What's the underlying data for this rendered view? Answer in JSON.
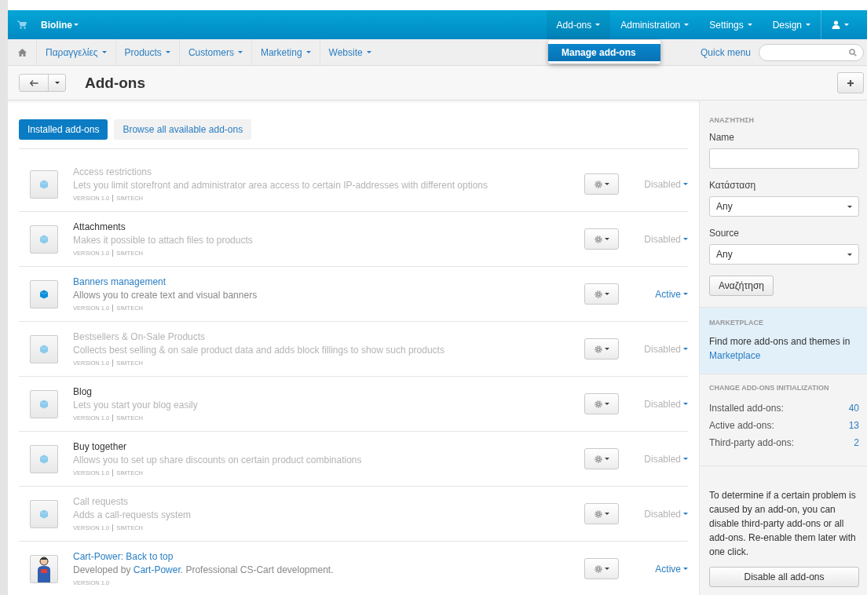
{
  "top_bar": {
    "store": "Bioline",
    "menus": [
      {
        "label": "Add-ons",
        "selected": true
      },
      {
        "label": "Administration",
        "selected": false
      },
      {
        "label": "Settings",
        "selected": false
      },
      {
        "label": "Design",
        "selected": false
      }
    ]
  },
  "dropdown": {
    "items": [
      {
        "label": "Manage add-ons",
        "selected": true
      }
    ]
  },
  "nav": {
    "items": [
      "Παραγγελίες",
      "Products",
      "Customers",
      "Marketing",
      "Website"
    ],
    "quick_menu": "Quick menu"
  },
  "title": "Add-ons",
  "tabs": [
    {
      "label": "Installed add-ons",
      "selected": true
    },
    {
      "label": "Browse all available add-ons",
      "selected": false
    }
  ],
  "addons": [
    {
      "kind": "cube",
      "name": "Access restrictions",
      "name_link": false,
      "name_dimmed": true,
      "description": [
        {
          "text": "Lets you limit storefront and administrator area access to certain IP-addresses with different options",
          "link": false
        }
      ],
      "version": "VERSION 1.0",
      "vendor": "SIMTECH",
      "status": "Disabled",
      "active": false
    },
    {
      "kind": "cube",
      "name": "Attachments",
      "name_link": false,
      "name_dimmed": false,
      "description": [
        {
          "text": "Makes it possible to attach files to products",
          "link": false
        }
      ],
      "version": "VERSION 1.0",
      "vendor": "SIMTECH",
      "status": "Disabled",
      "active": false
    },
    {
      "kind": "cube",
      "name": "Banners management",
      "name_link": true,
      "name_dimmed": false,
      "description": [
        {
          "text": "Allows you to create text and visual banners",
          "link": false
        }
      ],
      "version": "VERSION 1.0",
      "vendor": "SIMTECH",
      "status": "Active",
      "active": true
    },
    {
      "kind": "cube",
      "name": "Bestsellers & On-Sale Products",
      "name_link": false,
      "name_dimmed": true,
      "description": [
        {
          "text": "Collects best selling & on sale product data and adds block fillings to show such products",
          "link": false
        }
      ],
      "version": "VERSION 1.0",
      "vendor": "SIMTECH",
      "status": "Disabled",
      "active": false
    },
    {
      "kind": "cube",
      "name": "Blog",
      "name_link": false,
      "name_dimmed": false,
      "description": [
        {
          "text": "Lets you start your blog easily",
          "link": false
        }
      ],
      "version": "VERSION 1.0",
      "vendor": "SIMTECH",
      "status": "Disabled",
      "active": false
    },
    {
      "kind": "cube",
      "name": "Buy together",
      "name_link": false,
      "name_dimmed": false,
      "description": [
        {
          "text": "Allows you to set up share discounts on certain product combinations",
          "link": false
        }
      ],
      "version": "VERSION 1.0",
      "vendor": "SIMTECH",
      "status": "Disabled",
      "active": false
    },
    {
      "kind": "cube",
      "name": "Call requests",
      "name_link": false,
      "name_dimmed": true,
      "description": [
        {
          "text": "Adds a call-requests system",
          "link": false
        }
      ],
      "version": "VERSION 1.0",
      "vendor": "SIMTECH",
      "status": "Disabled",
      "active": false
    },
    {
      "kind": "figure",
      "name": "Cart-Power: Back to top",
      "name_link": true,
      "name_dimmed": false,
      "description": [
        {
          "text": "Developed by ",
          "link": false
        },
        {
          "text": "Cart-Power",
          "link": true
        },
        {
          "text": ". Professional CS-Cart development.",
          "link": false
        }
      ],
      "version": "VERSION 1.0",
      "status": "Active",
      "active": true
    }
  ],
  "sidebar": {
    "search": {
      "heading": "ΑΝΑΖΉΤΗΣΗ",
      "name_label": "Name",
      "status_label": "Κατάσταση",
      "status_value": "Any",
      "source_label": "Source",
      "source_value": "Any",
      "button": "Αναζήτηση"
    },
    "marketplace": {
      "heading": "MARKETPLACE",
      "text": "Find more add-ons and themes in",
      "link": "Marketplace"
    },
    "stats": {
      "heading": "CHANGE ADD-ONS INITIALIZATION",
      "rows": [
        {
          "label": "Installed add-ons:",
          "value": "40"
        },
        {
          "label": "Active add-ons:",
          "value": "13"
        },
        {
          "label": "Third-party add-ons:",
          "value": "2"
        }
      ]
    },
    "help": "To determine if a certain problem is caused by an add-on, you can disable third-party add-ons or all add-ons. Re-enable them later with one click.",
    "disable_button": "Disable all add-ons"
  }
}
